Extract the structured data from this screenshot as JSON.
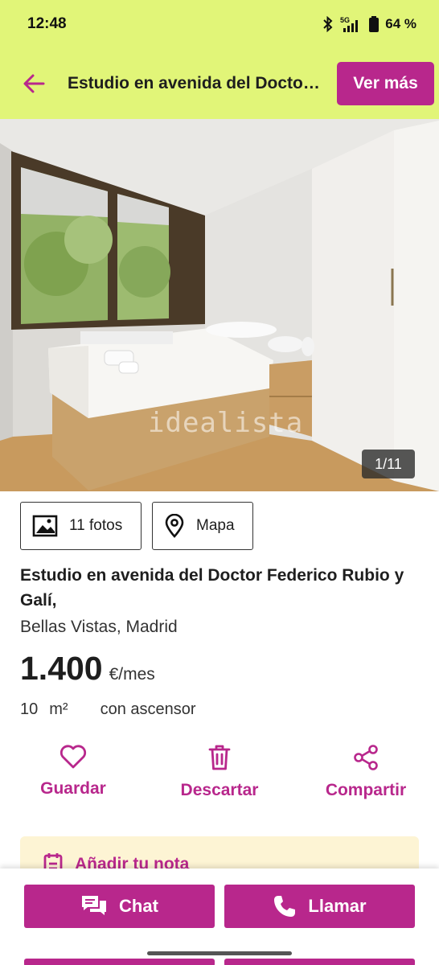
{
  "status_bar": {
    "time": "12:48",
    "network": "5G",
    "battery": "64 %",
    "icons": [
      "bluetooth-icon",
      "signal-icon",
      "battery-icon"
    ]
  },
  "top_bar": {
    "back_icon": "arrow-left-icon",
    "title": "Estudio en avenida del Doctor Federico Rubio y Galí,",
    "ver_mas_label": "Ver más"
  },
  "gallery": {
    "watermark": "idealista",
    "counter": "1/11"
  },
  "media": {
    "fotos_label": "11 fotos",
    "fotos_icon": "image-icon",
    "mapa_label": "Mapa",
    "mapa_icon": "map-pin-icon"
  },
  "listing": {
    "title": "Estudio en avenida del Doctor Federico Rubio y Galí,",
    "location": "Bellas Vistas, Madrid",
    "price": "1.400",
    "price_unit": "€/mes",
    "area_value": "10",
    "area_unit": "m²",
    "feature": "con ascensor"
  },
  "actions": {
    "save_label": "Guardar",
    "discard_label": "Descartar",
    "share_label": "Compartir"
  },
  "note": {
    "label": "Añadir tu nota"
  },
  "bottom": {
    "chat_label": "Chat",
    "call_label": "Llamar"
  },
  "colors": {
    "header": "#e1f578",
    "accent": "#b8278c",
    "note_bg": "#fdf4d4"
  }
}
